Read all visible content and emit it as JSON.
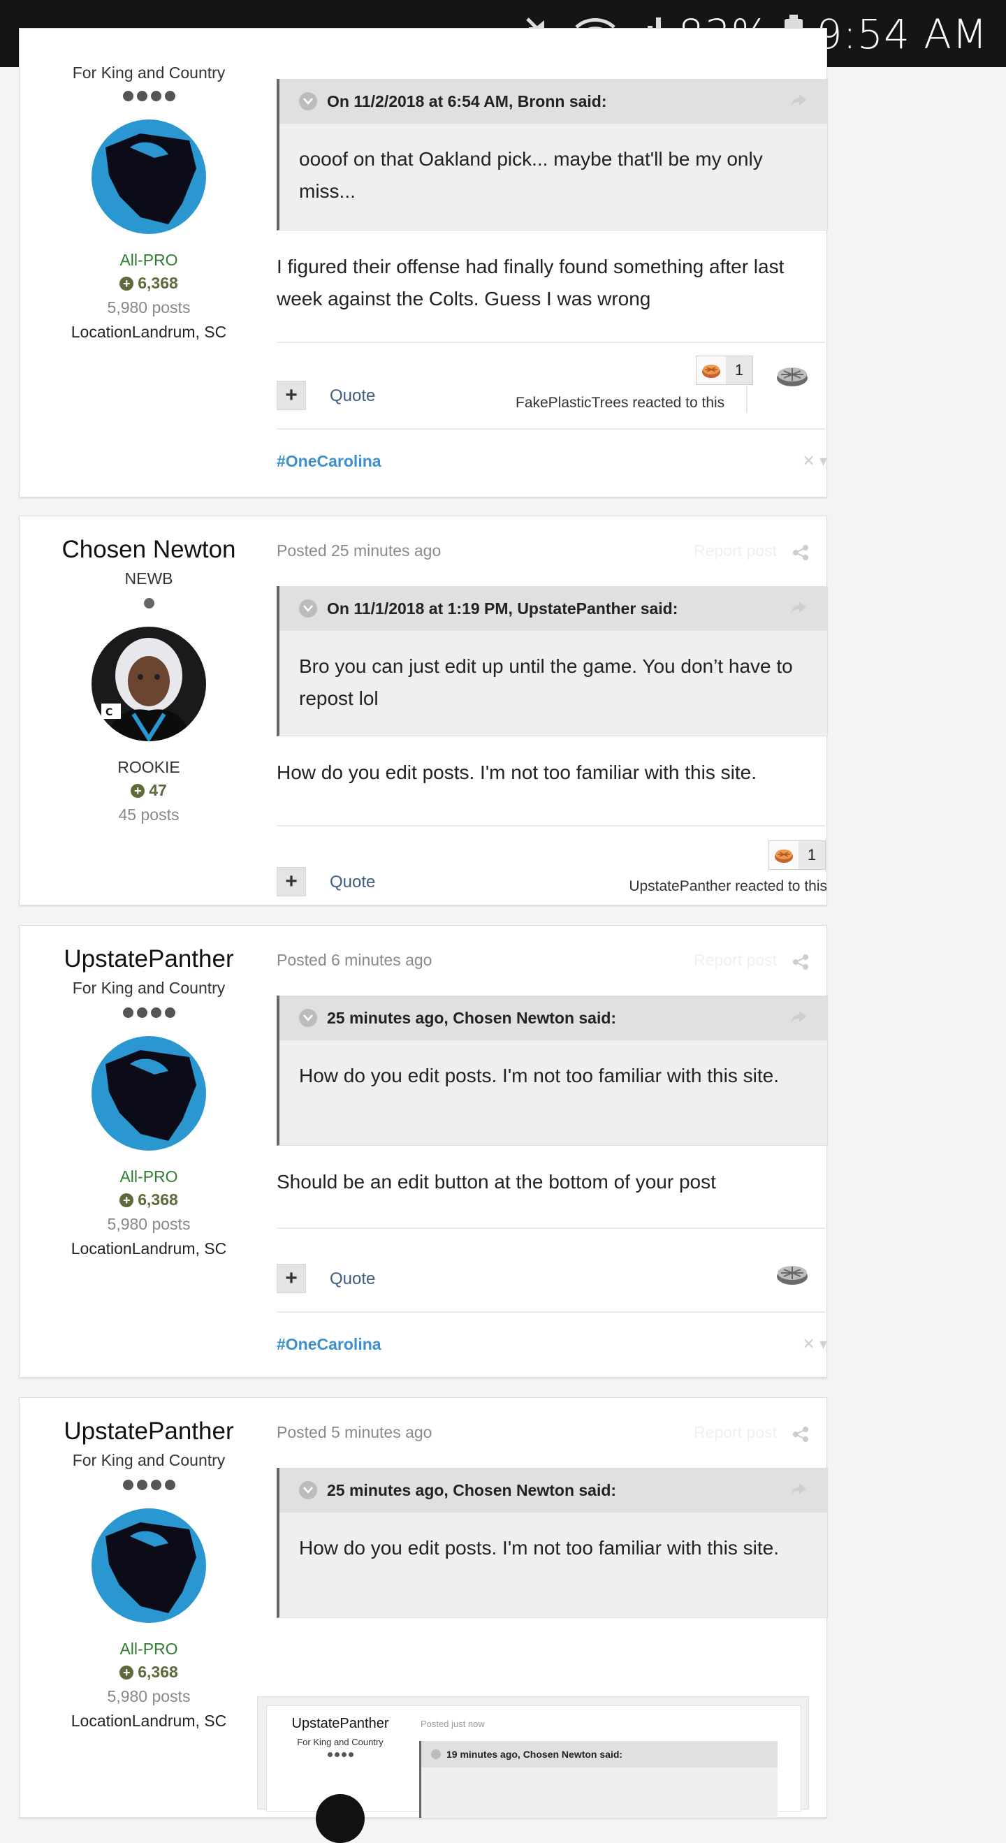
{
  "status_bar": {
    "battery": "83%",
    "time": "9:54 AM"
  },
  "posts": [
    {
      "author": {
        "rank": "For King and Country",
        "group": "All-PRO",
        "reputation": "6,368",
        "post_count": "5,980 posts",
        "location": "LocationLandrum, SC"
      },
      "quote": {
        "header": "On 11/2/2018 at 6:54 AM, Bronn said:",
        "body": "oooof on that Oakland pick... maybe that'll be my only miss..."
      },
      "body": "I figured their offense had finally found something after last week against the Colts. Guess I was wrong",
      "quote_label": "Quote",
      "reaction_count": "1",
      "reacted_text": "FakePlasticTrees reacted to this",
      "hashtag": "#OneCarolina",
      "menu_glyph": "✕ ▾"
    },
    {
      "author": {
        "name": "Chosen Newton",
        "rank": "NEWB",
        "group": "ROOKIE",
        "reputation": "47",
        "post_count": "45 posts"
      },
      "posted": "Posted 25 minutes ago",
      "report": "Report post",
      "quote": {
        "header": "On 11/1/2018 at 1:19 PM, UpstatePanther said:",
        "body": "Bro you can just edit up until the game. You don’t have to repost lol"
      },
      "body": "How do you edit posts. I'm not too familiar with this site.",
      "quote_label": "Quote",
      "reaction_count": "1",
      "reacted_text": "UpstatePanther reacted to this"
    },
    {
      "author": {
        "name": "UpstatePanther",
        "rank": "For King and Country",
        "group": "All-PRO",
        "reputation": "6,368",
        "post_count": "5,980 posts",
        "location": "LocationLandrum, SC"
      },
      "posted": "Posted 6 minutes ago",
      "report": "Report post",
      "quote": {
        "header": "25 minutes ago, Chosen Newton said:",
        "body": "How do you edit posts. I'm not too familiar with this site."
      },
      "body": "Should be an edit button at the bottom of your post",
      "quote_label": "Quote",
      "hashtag": "#OneCarolina",
      "menu_glyph": "✕ ▾"
    },
    {
      "author": {
        "name": "UpstatePanther",
        "rank": "For King and Country",
        "group": "All-PRO",
        "reputation": "6,368",
        "post_count": "5,980 posts",
        "location": "LocationLandrum, SC"
      },
      "posted": "Posted 5 minutes ago",
      "report": "Report post",
      "quote": {
        "header": "25 minutes ago, Chosen Newton said:",
        "body": "How do you edit posts. I'm not too familiar with this site."
      },
      "embed": {
        "name": "UpstatePanther",
        "rank": "For King and Country",
        "posted": "Posted just now",
        "quote_header": "19 minutes ago, Chosen Newton said:"
      }
    }
  ]
}
